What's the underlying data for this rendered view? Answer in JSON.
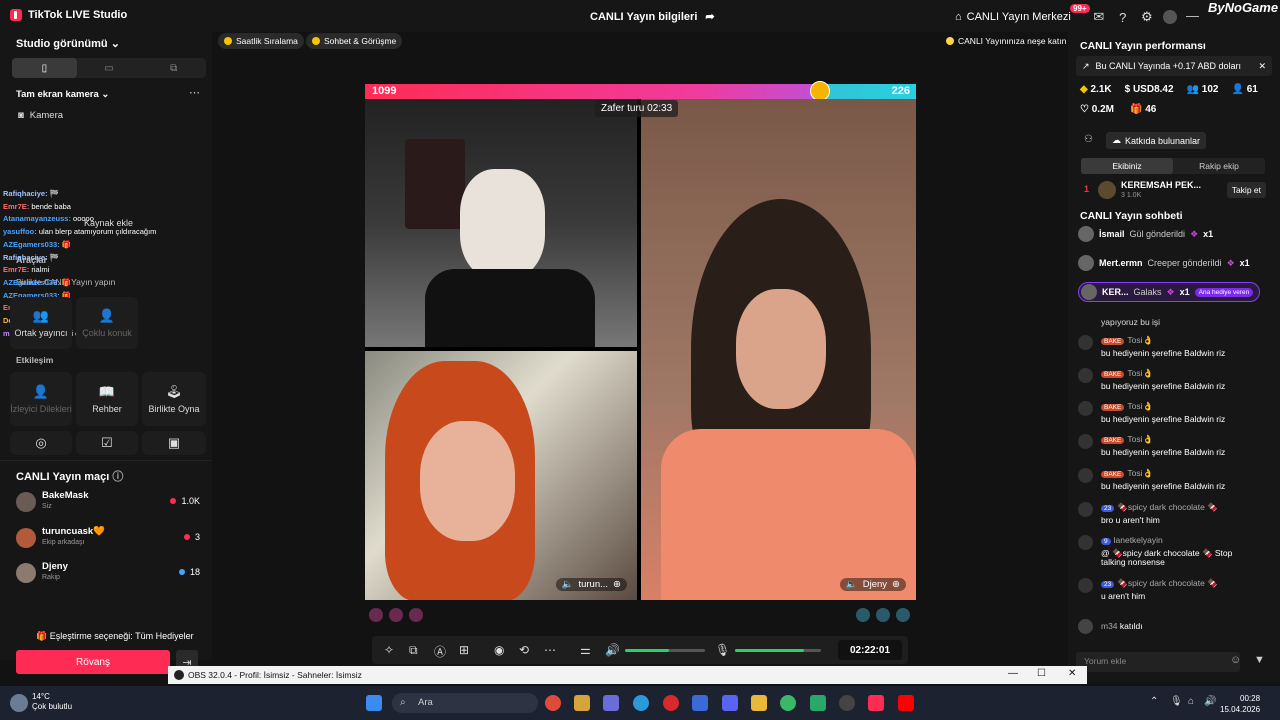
{
  "window": {
    "app_title": "TikTok LIVE Studio",
    "center_title": "CANLI Yayın bilgileri",
    "live_center": "CANLI Yayın Merkezi",
    "notif_count": "99+",
    "watermark": "ByNoGame"
  },
  "left": {
    "studio_view": "Studio görünümü",
    "source_label": "Tam ekran kamera",
    "camera_label": "Kamera",
    "add_source": "Kaynak ekle",
    "tools_label": "Araçlar",
    "together_live": "Birlikte CANLI Yayın yapın",
    "co_host": "Ortak yayıncı",
    "multi_guest": "Çoklu konuk",
    "interaction": "Etkileşim",
    "viewer_requests": "İzleyici Dilekleri",
    "guide": "Rehber",
    "play_together": "Birlikte Oyna",
    "match_title": "CANLI Yayın maçı",
    "match_setting": "Eşleştirme seçeneği: Tüm Hediyeler",
    "rematch": "Rövanş",
    "chat_overlay": [
      {
        "name": "Rafiqhaciye:",
        "text": "🏁",
        "color": "#9ec1ff"
      },
      {
        "name": "Emr7E:",
        "text": "bende baba",
        "color": "#ff6b6b"
      },
      {
        "name": "Atanamayanzeuss:",
        "text": "ooooo",
        "color": "#4aa3ff"
      },
      {
        "name": "yasuffoo:",
        "text": "ulan blerp atamıyorum çıldıracağım",
        "color": "#4aa3ff"
      },
      {
        "name": "AZEgamers033:",
        "text": "🎁",
        "color": "#4aa3ff"
      },
      {
        "name": "Rafiqhaciye:",
        "text": "🏁",
        "color": "#9ec1ff"
      },
      {
        "name": "Emr7E:",
        "text": "rialmi",
        "color": "#ff6b6b"
      },
      {
        "name": "AZEgamers033:",
        "text": "🎁",
        "color": "#4aa3ff"
      },
      {
        "name": "AZEgamers033:",
        "text": "🎁",
        "color": "#4aa3ff"
      },
      {
        "name": "Emr7E:",
        "text": "selin",
        "color": "#ff6b6b"
      },
      {
        "name": "Destiny25:",
        "text": "🎁",
        "color": "#ffb347"
      },
      {
        "name": "muhetimaskb:",
        "text": "ilgimi çekti",
        "color": "#c08bff"
      }
    ],
    "match_rows": [
      {
        "name": "BakeMask",
        "sub": "Siz",
        "value": "1.0K",
        "dot": "#fe2c55",
        "avatar": "#6b5b55"
      },
      {
        "name": "turuncuask🧡",
        "sub": "Ekip arkadaşı",
        "value": "3",
        "dot": "#fe2c55",
        "avatar": "#b45a3c"
      },
      {
        "name": "Djeny",
        "sub": "Rakip",
        "value": "18",
        "dot": "#3ea6ff",
        "avatar": "#8a7a70"
      }
    ]
  },
  "center": {
    "chip_hourly": "Saatlik Sıralama",
    "chip_chat": "Sohbet & Görüşme",
    "chip_note": "CANLI Yayınınıza neşe katın",
    "score_left": "1099",
    "score_right": "226",
    "victory_timer": "Zafer turu 02:33",
    "guest1": "turun...",
    "guest2": "Djeny",
    "clock": "02:22:01",
    "volume_level": 0.55,
    "mic_level": 0.8
  },
  "right": {
    "perf_title": "CANLI Yayın performansı",
    "earning": "Bu CANLI Yayında +0.17 ABD doları",
    "stat_coins": "2.1K",
    "stat_usd": "USD8.42",
    "stat_viewers": "102",
    "stat_new": "61",
    "stat_likes": "0.2M",
    "stat_gifters": "46",
    "contributors": "Katkıda bulunanlar",
    "tab_ours": "Ekibiniz",
    "tab_rival": "Rakip ekip",
    "rank_num": "1",
    "rank_name": "KEREMSAH PEK...",
    "rank_stats": "3  1.0K",
    "follow": "Takip et",
    "chat_title": "CANLI Yayın sohbeti",
    "gifts": [
      {
        "name": "İsmail",
        "text": "Gül gönderildi",
        "count": "x1"
      },
      {
        "name": "Mert.ermn",
        "text": "Creeper gönderildi",
        "count": "x1"
      },
      {
        "name": "KER...",
        "text": "Galaks",
        "count": "x1",
        "badge": "Ana hediye veren"
      }
    ],
    "chat_partial": "yapıyoruz bu işi",
    "comments": [
      {
        "lvl": "BAKE",
        "name": "Tosi👌",
        "text": "bu hediyenin şerefine Baldwin riz"
      },
      {
        "lvl": "BAKE",
        "name": "Tosi👌",
        "text": "bu hediyenin şerefine Baldwin riz"
      },
      {
        "lvl": "BAKE",
        "name": "Tosi👌",
        "text": "bu hediyenin şerefine Baldwin riz"
      },
      {
        "lvl": "BAKE",
        "name": "Tosi👌",
        "text": "bu hediyenin şerefine Baldwin riz"
      },
      {
        "lvl": "BAKE",
        "name": "Tosi👌",
        "text": "bu hediyenin şerefine Baldwin riz"
      },
      {
        "lvl": "23",
        "name": "🍫spicy dark chocolate 🍫",
        "text": "bro u aren't him"
      },
      {
        "lvl": "9",
        "name": "lanetkelyayin",
        "text": "@ 🍫spicy dark chocolate 🍫 Stop"
      },
      {
        "lvl": "23",
        "name": "🍫spicy dark chocolate 🍫",
        "text": "u aren't him"
      }
    ],
    "comment_extra": "talking nonsense",
    "joined_name": "m34",
    "joined_text": "katıldı",
    "comment_placeholder": "Yorum ekle"
  },
  "obs": {
    "title": "OBS 32.0.4 - Profil: İsimsiz - Sahneler: İsimsiz"
  },
  "taskbar": {
    "temp": "14°C",
    "weather": "Çok bulutlu",
    "search": "Ara",
    "time": "00:28",
    "date": "15.04.2026"
  }
}
